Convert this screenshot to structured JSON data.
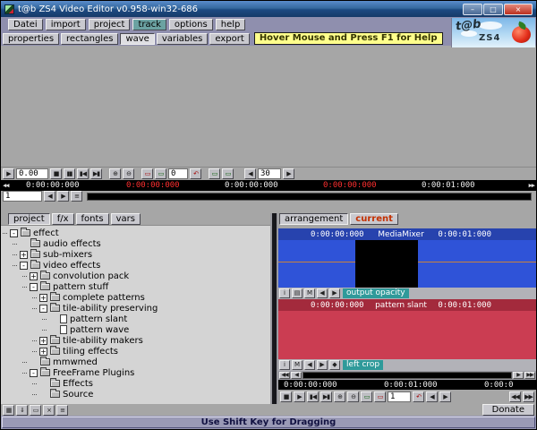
{
  "window": {
    "title": "t@b ZS4 Video Editor v0.958-win32-686",
    "minimize_glyph": "–",
    "maximize_glyph": "□",
    "close_glyph": "×"
  },
  "menubar": {
    "items": [
      "Datei",
      "import",
      "project",
      "track",
      "options",
      "help"
    ]
  },
  "tabbar": {
    "items": [
      "properties",
      "rectangles",
      "wave",
      "variables",
      "export"
    ],
    "tooltip": "Hover Mouse and Press F1 for Help"
  },
  "logo": {
    "script": "t@b",
    "name": "ZS4"
  },
  "transport_top": {
    "speed": "0.00",
    "offset": "0",
    "fps": "30"
  },
  "ruler_top": {
    "tick1": "0:00:00:000",
    "tick2": "0:00:00:000",
    "tick3": "0:00:00:000",
    "tick4": "0:00:00:000",
    "tick5": "0:00:01:000"
  },
  "track_row": {
    "value": "1"
  },
  "left_panel": {
    "tabs": [
      "project",
      "f/x",
      "fonts",
      "vars"
    ],
    "tree": [
      {
        "label": "effect",
        "toggle": "-"
      },
      {
        "label": "audio effects",
        "toggle": ""
      },
      {
        "label": "sub-mixers",
        "toggle": "+"
      },
      {
        "label": "video effects",
        "toggle": "-"
      },
      {
        "label": "convolution pack",
        "toggle": "+"
      },
      {
        "label": "pattern stuff",
        "toggle": "-"
      },
      {
        "label": "complete patterns",
        "toggle": "+"
      },
      {
        "label": "tile-ability preserving",
        "toggle": "-"
      },
      {
        "label": "pattern slant",
        "toggle": ""
      },
      {
        "label": "pattern wave",
        "toggle": ""
      },
      {
        "label": "tile-ability makers",
        "toggle": "+"
      },
      {
        "label": "tiling effects",
        "toggle": "+"
      },
      {
        "label": "mmwmed",
        "toggle": ""
      },
      {
        "label": "FreeFrame Plugins",
        "toggle": "-"
      },
      {
        "label": "Effects",
        "toggle": ""
      },
      {
        "label": "Source",
        "toggle": ""
      }
    ]
  },
  "right_panel": {
    "tabs": [
      "arrangement",
      "current"
    ],
    "track1": {
      "start": "0:00:00:000",
      "name": "MediaMixer",
      "end": "0:00:01:000",
      "envelope": "output opacity"
    },
    "track2": {
      "start": "0:00:00:000",
      "name": "pattern slant",
      "end": "0:00:01:000",
      "envelope": "left crop"
    },
    "ruler_bottom": {
      "tick1": "0:00:00:000",
      "tick2": "0:00:01:000",
      "tick3": "0:00:0"
    },
    "transport_value": "1"
  },
  "bottom": {
    "donate": "Donate",
    "status": "Use Shift Key for Dragging"
  },
  "icons": {
    "play": "▶",
    "stop": "■",
    "pause": "▮▮",
    "to_start": "▮◀",
    "to_end": "▶▮",
    "zoom_in": "⊕",
    "zoom_out": "⊖",
    "clip": "▭",
    "undo": "↶",
    "prev": "◀",
    "next": "▶",
    "menu": "≡",
    "info": "i",
    "mute": "M",
    "list": "▤",
    "diamond": "◆",
    "rew2": "◀◀",
    "fwd2": "▶▶",
    "grid": "▦",
    "down": "⇓",
    "close": "×"
  },
  "colors": {
    "track1_header": "#2743ae",
    "track1_body": "#2f53d8",
    "track2_header": "#a32a3c",
    "track2_body": "#cb3d52",
    "envelope_bg": "#2f9a9a",
    "ruler_emph": "#ff2f2f",
    "tooltip_bg": "#ffff8c"
  }
}
